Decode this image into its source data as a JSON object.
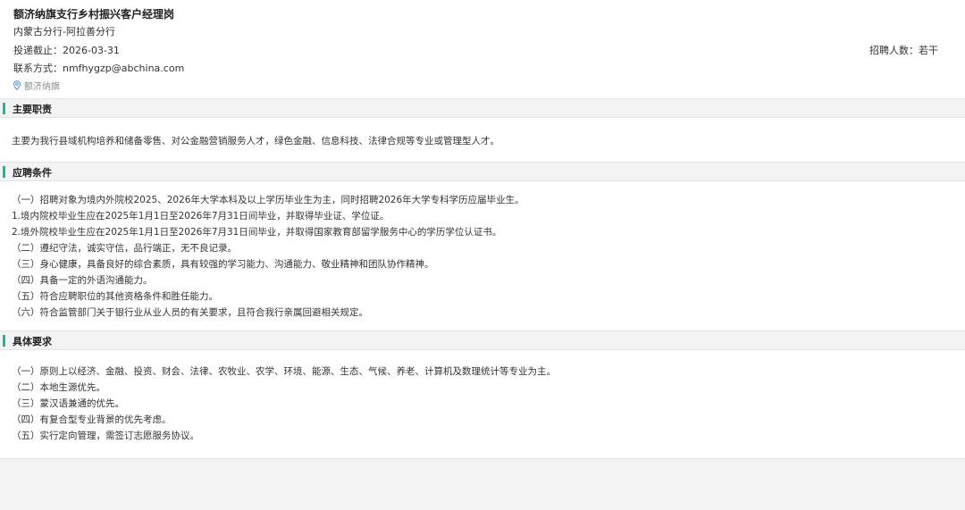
{
  "job": {
    "title": "额济纳旗支行乡村振兴客户经理岗",
    "branch": "内蒙古分行-阿拉善分行",
    "deadline": "投递截止：2026-03-31",
    "headcount": "招聘人数：若干",
    "contact": "联系方式：nmfhygzp@abchina.com",
    "location": "额济纳旗"
  },
  "sections": {
    "duties": {
      "title": "主要职责",
      "lines": [
        "主要为我行县域机构培养和储备零售、对公金融营销服务人才，绿色金融、信息科技、法律合规等专业或管理型人才。"
      ]
    },
    "conditions": {
      "title": "应聘条件",
      "lines": [
        "（一）招聘对象为境内外院校2025、2026年大学本科及以上学历毕业生为主，同时招聘2026年大学专科学历应届毕业生。",
        "1.境内院校毕业生应在2025年1月1日至2026年7月31日间毕业，并取得毕业证、学位证。",
        "2.境外院校毕业生应在2025年1月1日至2026年7月31日间毕业，并取得国家教育部留学服务中心的学历学位认证书。",
        "（二）遵纪守法，诚实守信，品行端正，无不良记录。",
        "（三）身心健康，具备良好的综合素质，具有较强的学习能力、沟通能力、敬业精神和团队协作精神。",
        "（四）具备一定的外语沟通能力。",
        "（五）符合应聘职位的其他资格条件和胜任能力。",
        "（六）符合监管部门关于银行业从业人员的有关要求，且符合我行亲属回避相关规定。"
      ]
    },
    "requirements": {
      "title": "具体要求",
      "lines": [
        "（一）原则上以经济、金融、投资、财会、法律、农牧业、农学、环境、能源、生态、气候、养老、计算机及数理统计等专业为主。",
        "（二）本地生源优先。",
        "（三）蒙汉语兼通的优先。",
        "（四）有复合型专业背景的优先考虑。",
        "（五）实行定向管理，需签订志愿服务协议。"
      ]
    }
  },
  "colors": {
    "accent": "#1bb99a",
    "page_bg": "#f3f3f4",
    "card_bg": "#ffffff",
    "muted_text": "#8a8a8a"
  },
  "icons": {
    "location": "map-pin-icon"
  }
}
